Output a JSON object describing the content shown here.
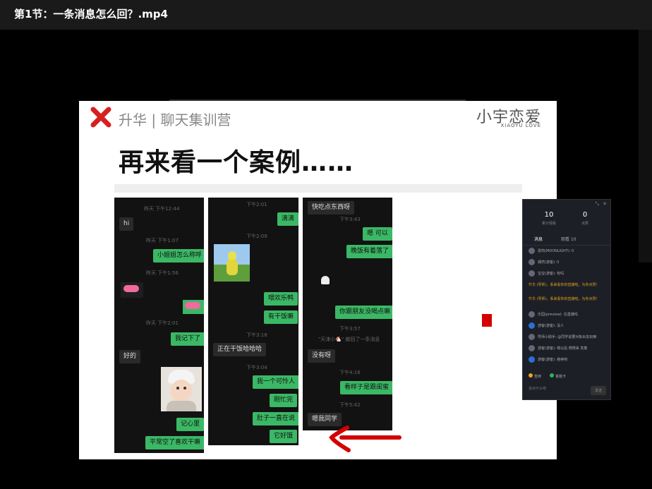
{
  "window": {
    "title": "第1节：一条消息怎么回？.mp4"
  },
  "slide": {
    "brand": "升华 | 聊天集训营",
    "logo_cn": "小宇恋爱",
    "logo_en": "XIAOYU LOVE",
    "headline": "再来看一个案例……"
  },
  "chat1": {
    "ts1": "昨天 下午12:44",
    "m1": "hi",
    "ts2": "昨天 下午1:07",
    "m2": "小姐姐怎么称呼",
    "ts3": "昨天 下午1:56",
    "ts4": "昨天 下午2:01",
    "m3": "我记下了",
    "m4": "好的",
    "m5": "记心里",
    "m6": "平常空了喜欢干嘛"
  },
  "chat2": {
    "ts1": "下午2:01",
    "m1": "滴滴",
    "ts2": "下午2:09",
    "m2": "喂欢乐鸭",
    "m3": "有干饭嘛",
    "ts3": "下午3:18",
    "m4": "正在干饭哈哈哈",
    "ts4": "下午3:04",
    "m5": "我一个可怜人",
    "m6": "刚忙完",
    "m7": "肚子一直在说",
    "m8": "它好饿"
  },
  "chat3": {
    "m1": "快吃点东西呀",
    "ts1": "下午3:43",
    "m2": "嗯 可以",
    "m3": "晚饭有着落了",
    "m4": "你跟朋友没喝点嘛",
    "ts2": "下午3:57",
    "sys": "\"天津小🐔\" 撤回了一条消息",
    "m5": "没有呀",
    "ts3": "下午4:16",
    "m6": "看样子是跟闺蜜",
    "ts4": "下午5:42",
    "m7": "嗯我同学"
  },
  "panel": {
    "stat1_value": "10",
    "stat1_label": "累计观看",
    "stat2_value": "0",
    "stat2_label": "点赞",
    "tab1": "消息",
    "tab2": "观看 10",
    "r1": "雷鸣(MOONLIGHT): 0",
    "r2": "偶然(游客): 0",
    "r3": "宝宝(游客): 有吗",
    "o1": "升华 (导师)，系来看你的直播啦，为你点赞！",
    "o2": "升华 (导师)，系来看你的直播啦，为你点赞！",
    "r4": "乐园(preview): 在直播吗",
    "r5": "游客(游客): 没人",
    "r6": "导师小助手: @同学说要对象出去玩嘛",
    "r7": "游客(游客): 嗯以后 慢慢来 发着",
    "r8": "游客(游客): 继续吧",
    "btn1": "签到",
    "btn2": "答题卡",
    "input": "说点什么吧",
    "send": "发送"
  },
  "colors": {
    "wechat_green": "#3bb865",
    "slide_red": "#d40000"
  }
}
